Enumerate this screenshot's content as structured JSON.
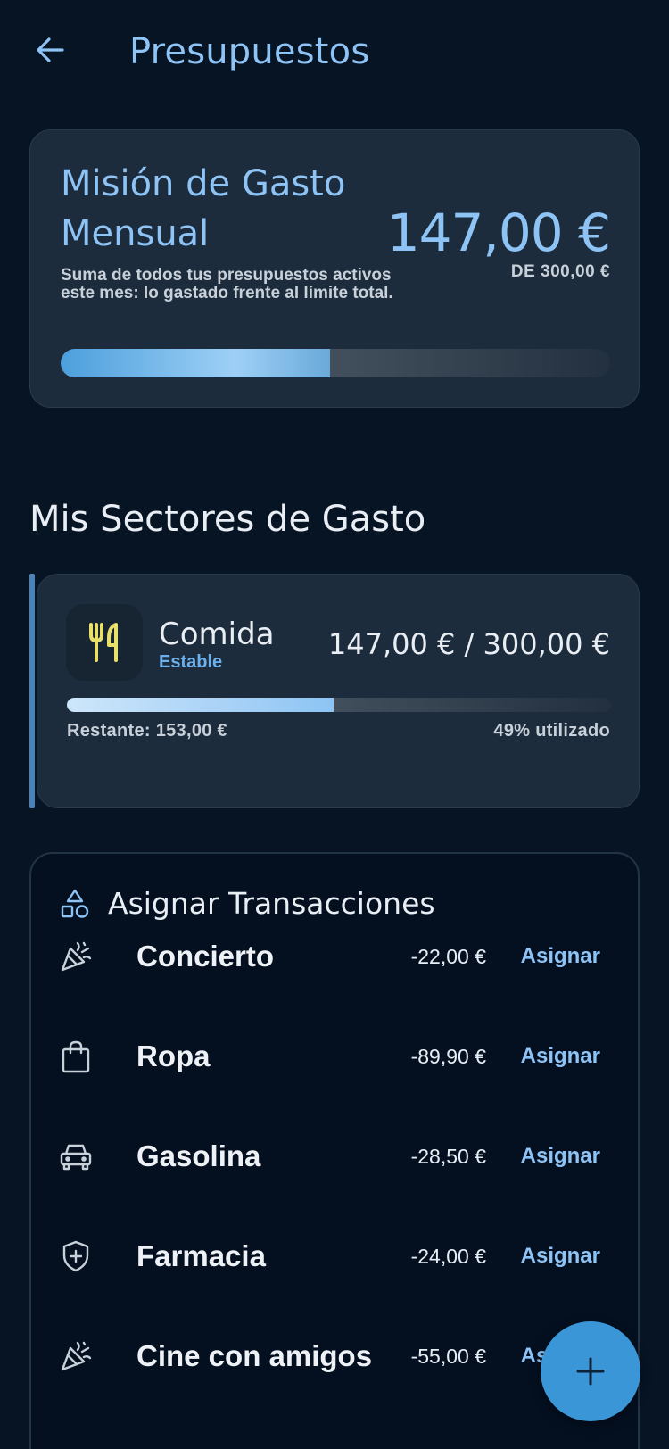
{
  "header": {
    "title": "Presupuestos"
  },
  "mission": {
    "title": "Misión de Gasto Mensual",
    "description": "Suma de todos tus presupuestos activos este mes: lo gastado frente al límite total.",
    "amount": "147,00 €",
    "limit": "DE 300,00 €",
    "progress": 0.49
  },
  "sectors": {
    "title": "Mis Sectores de Gasto",
    "items": [
      {
        "icon": "utensils-icon",
        "name": "Comida",
        "status": "Estable",
        "amount": "147,00 € / 300,00 €",
        "remaining": "Restante: 153,00 €",
        "used": "49% utilizado",
        "progress": 0.49
      }
    ]
  },
  "assign": {
    "title": "Asignar Transacciones",
    "action_label": "Asignar",
    "transactions": [
      {
        "icon": "party-popper-icon",
        "name": "Concierto",
        "amount": "-22,00 €"
      },
      {
        "icon": "shopping-bag-icon",
        "name": "Ropa",
        "amount": "-89,90 €"
      },
      {
        "icon": "car-icon",
        "name": "Gasolina",
        "amount": "-28,50 €"
      },
      {
        "icon": "shield-plus-icon",
        "name": "Farmacia",
        "amount": "-24,00 €"
      },
      {
        "icon": "party-popper-icon",
        "name": "Cine con amigos",
        "amount": "-55,00 €"
      }
    ]
  },
  "colors": {
    "background": "#061424",
    "card": "#1d2c3c",
    "accent": "#8ec3f5",
    "fab": "#3a96d6",
    "utensils": "#e8e06a"
  }
}
